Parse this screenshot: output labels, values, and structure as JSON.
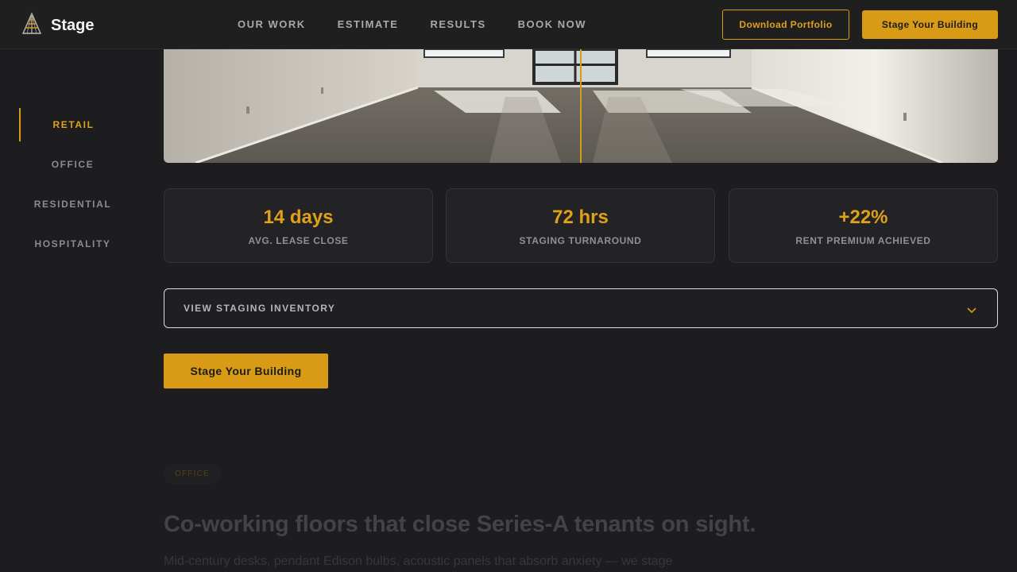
{
  "header": {
    "brand": "Stage",
    "logo_icon": "tower-logo-icon",
    "nav": [
      "OUR WORK",
      "ESTIMATE",
      "RESULTS",
      "BOOK NOW"
    ],
    "download_label": "Download Portfolio",
    "stage_label": "Stage Your Building"
  },
  "sidebar": {
    "items": [
      {
        "label": "RETAIL",
        "active": true
      },
      {
        "label": "OFFICE",
        "active": false
      },
      {
        "label": "RESIDENTIAL",
        "active": false
      },
      {
        "label": "HOSPITALITY",
        "active": false
      }
    ]
  },
  "hero": {
    "comparison_split": 0.5
  },
  "stats": [
    {
      "value": "14 days",
      "label": "AVG. LEASE CLOSE"
    },
    {
      "value": "72 hrs",
      "label": "STAGING TURNAROUND"
    },
    {
      "value": "+22%",
      "label": "RENT PREMIUM ACHIEVED"
    }
  ],
  "inventory": {
    "label": "VIEW STAGING INVENTORY",
    "icon": "chevron-down-icon"
  },
  "cta": {
    "label": "Stage Your Building"
  },
  "next_section": {
    "tag": "OFFICE",
    "title": "Co-working floors that close Series-A tenants on sight.",
    "body": "Mid-century desks, pendant Edison bulbs, acoustic panels that absorb anxiety — we stage"
  },
  "colors": {
    "accent": "#d99a16",
    "background": "#1d1d1f",
    "card": "#232325"
  }
}
